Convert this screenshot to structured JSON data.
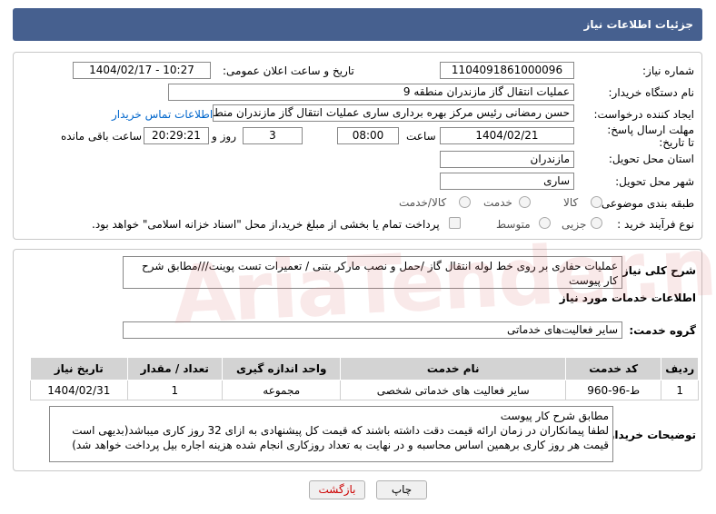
{
  "header": {
    "title": "جزئیات اطلاعات نیاز"
  },
  "need_number": {
    "label": "شماره نیاز:",
    "value": "1104091861000096"
  },
  "announce_datetime": {
    "label": "تاریخ و ساعت اعلان عمومی:",
    "value": "1404/02/17 - 10:27"
  },
  "buyer_org": {
    "label": "نام دستگاه خریدار:",
    "value": "عملیات انتقال گاز مازندران منطقه 9"
  },
  "requester": {
    "label": "ایجاد کننده درخواست:",
    "value": "حسن رمضانی رئیس مرکز بهره برداری ساری عملیات انتقال گاز مازندران منطقه",
    "contact_link": "اطلاعات تماس خریدار"
  },
  "deadline": {
    "label": "مهلت ارسال پاسخ: تا تاریخ:",
    "date": "1404/02/21",
    "time_label": "ساعت",
    "time": "08:00",
    "days": "3",
    "days_label": "روز و",
    "remaining": "20:29:21",
    "remaining_label": "ساعت باقی مانده"
  },
  "province": {
    "label": "استان محل تحویل:",
    "value": "مازندران"
  },
  "city": {
    "label": "شهر محل تحویل:",
    "value": "ساری"
  },
  "category": {
    "label": "طبقه بندی موضوعی:",
    "options": [
      "کالا",
      "خدمت",
      "کالا/خدمت"
    ],
    "selected": "خدمت"
  },
  "process_type": {
    "label": "نوع فرآیند خرید :",
    "options": [
      "جزیی",
      "متوسط"
    ],
    "payment_note": "پرداخت تمام یا بخشی از مبلغ خرید،از محل \"اسناد خزانه اسلامی\" خواهد بود."
  },
  "general_desc": {
    "label": "شرح کلی نیاز:",
    "value": "عملیات حفاری بر روی خط لوله انتقال گاز /حمل و نصب مارکر بتنی / تعمیرات تست پوینت///مطابق شرح کار پیوست"
  },
  "services_section": {
    "title": "اطلاعات خدمات مورد نیاز"
  },
  "service_group": {
    "label": "گروه خدمت:",
    "value": "سایر فعالیت‌های خدماتی"
  },
  "table": {
    "headers": [
      "ردیف",
      "کد خدمت",
      "نام خدمت",
      "واحد اندازه گیری",
      "تعداد / مقدار",
      "تاریخ نیاز"
    ],
    "rows": [
      [
        "1",
        "ط-96-960",
        "سایر فعالیت های خدماتی شخصی",
        "مجموعه",
        "1",
        "1404/02/31"
      ]
    ]
  },
  "buyer_notes": {
    "label": "توضیحات خریدار:",
    "line1": "مطابق شرح کار پیوست",
    "line2": "لطفا پیمانکاران در زمان ارائه قیمت دقت داشته باشند که قیمت کل پیشنهادی به ازای 32 روز کاری میباشد(بدیهی است قیمت هر روز کاری برهمین اساس محاسبه و در نهایت به تعداد روزکاری انجام شده هزینه اجاره بیل پرداخت خواهد شد)"
  },
  "buttons": {
    "print": "چاپ",
    "back": "بازگشت"
  },
  "watermark": {
    "text": "AriaTender.neT"
  },
  "colors": {
    "header_bg": "#46608f",
    "link": "#0066cc",
    "back_text": "#cc0000"
  }
}
